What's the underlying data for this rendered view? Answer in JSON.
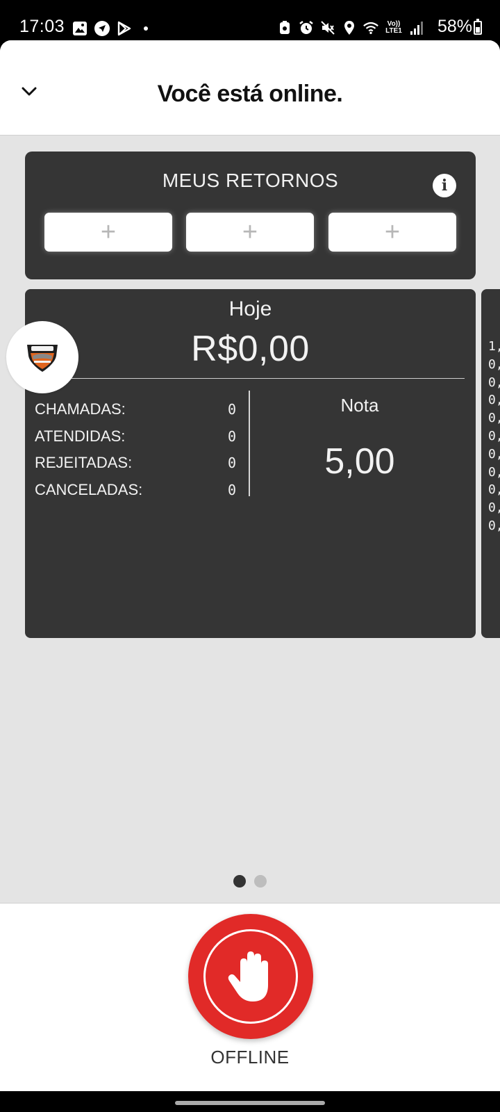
{
  "status_bar": {
    "time": "17:03",
    "battery": "58%",
    "lte_top": "Vo))",
    "lte_bottom": "LTE1"
  },
  "header": {
    "title": "Você está online.",
    "back_icon": "chevron-down-icon"
  },
  "returns": {
    "title": "MEUS RETORNOS",
    "info_icon": "info-icon",
    "slots": [
      "+",
      "+",
      "+"
    ]
  },
  "today": {
    "label": "Hoje",
    "amount": "R$0,00",
    "stats": [
      {
        "label": "CHAMADAS:",
        "value": "0"
      },
      {
        "label": "ATENDIDAS:",
        "value": "0"
      },
      {
        "label": "REJEITADAS:",
        "value": "0"
      },
      {
        "label": "CANCELADAS:",
        "value": "0"
      }
    ],
    "rating_label": "Nota",
    "rating_value": "5,00"
  },
  "next_card": {
    "values": [
      "1,",
      "0,",
      "0,",
      "0,",
      "0,",
      "0,",
      "0,",
      "0,",
      "0,",
      "0,",
      "0,"
    ]
  },
  "pager": {
    "pages": 2,
    "active": 0
  },
  "bottom": {
    "button_icon": "hand-stop-icon",
    "button_label": "OFFLINE"
  },
  "colors": {
    "card_bg": "#353535",
    "page_bg": "#e4e4e4",
    "offline_red": "#e12a28"
  }
}
